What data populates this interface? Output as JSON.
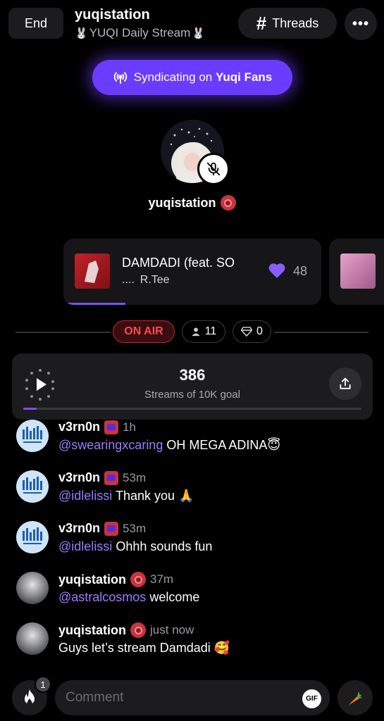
{
  "header": {
    "end_label": "End",
    "station_name": "yuqistation",
    "stream_title": "YUQI Daily Stream",
    "threads_label": "Threads",
    "more_label": "•••"
  },
  "syndicate": {
    "prefix": "Syndicating on ",
    "target": "Yuqi Fans"
  },
  "host": {
    "name": "yuqistation"
  },
  "now_playing": {
    "title": "DAMDADI (feat. SO",
    "artist_prefix": "....",
    "artist": "R.Tee",
    "likes": "48",
    "progress": 0.24
  },
  "status": {
    "on_air": "ON AIR",
    "listeners": "11",
    "gems": "0"
  },
  "goal": {
    "count": "386",
    "label": "Streams of 10K goal",
    "progress": 0.04
  },
  "comments": [
    {
      "user": "v3rn0n",
      "time": "1h",
      "mention": "@swearingxcaring",
      "text": "OH MEGA ADINA😇"
    },
    {
      "user": "v3rn0n",
      "time": "53m",
      "mention": "@idlelissi",
      "text": "Thank you 🙏"
    },
    {
      "user": "v3rn0n",
      "time": "53m",
      "mention": "@idlelissi",
      "text": "Ohhh sounds fun"
    },
    {
      "user": "yuqistation",
      "time": "37m",
      "mention": "@astralcosmos",
      "text": "welcome"
    },
    {
      "user": "yuqistation",
      "time": "just now",
      "mention": "",
      "text": "Guys let’s stream Damdadi 🥰"
    }
  ],
  "composer": {
    "placeholder": "Comment",
    "gif_label": "GIF",
    "notification_count": "1"
  },
  "colors": {
    "accent": "#7c4dff",
    "syndicate_bg": "#6a3cff",
    "on_air": "#ff4a55",
    "mention": "#9d7bff"
  }
}
